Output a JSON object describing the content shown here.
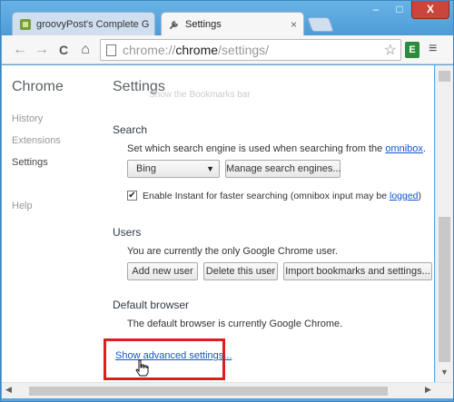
{
  "window": {
    "controls": {
      "minimize": "–",
      "maximize": "□",
      "close": "X"
    }
  },
  "tabs": [
    {
      "label": "groovyPost's Complete G",
      "icon": "groovypost-favicon",
      "active": false
    },
    {
      "label": "Settings",
      "icon": "wrench-icon",
      "active": true
    }
  ],
  "tab_close_glyph": "×",
  "toolbar": {
    "back": "←",
    "forward": "→",
    "reload": "C",
    "home": "⌂",
    "url_prefix": "chrome://",
    "url_host": "chrome",
    "url_path": "/settings/",
    "star": "☆",
    "extension": "E",
    "menu": "≡"
  },
  "sidebar": {
    "title": "Chrome",
    "items": [
      {
        "label": "History",
        "selected": false
      },
      {
        "label": "Extensions",
        "selected": false
      },
      {
        "label": "Settings",
        "selected": true
      },
      {
        "label": "Help",
        "selected": false
      }
    ]
  },
  "settings": {
    "title": "Settings",
    "ghost_text": "Show the Bookmarks bar",
    "search": {
      "title": "Search",
      "description_prefix": "Set which search engine is used when searching from the ",
      "description_link": "omnibox",
      "description_suffix": ".",
      "engine_selected": "Bing",
      "select_arrow": "▼",
      "manage_button": "Manage search engines...",
      "instant_checked": "✔",
      "instant_prefix": "Enable Instant for faster searching (omnibox input may be ",
      "instant_link": "logged",
      "instant_suffix": ")"
    },
    "users": {
      "title": "Users",
      "description": "You are currently the only Google Chrome user.",
      "add_button": "Add new user",
      "delete_button": "Delete this user",
      "import_button": "Import bookmarks and settings..."
    },
    "default_browser": {
      "title": "Default browser",
      "description": "The default browser is currently Google Chrome."
    },
    "advanced_link": "Show advanced settings..."
  },
  "scrollbars": {
    "up": "▲",
    "down": "▼",
    "left": "◀",
    "right": "▶"
  },
  "colors": {
    "highlight": "#e01d1d",
    "link": "#1155cc",
    "title_bar": "#5aa5de"
  }
}
